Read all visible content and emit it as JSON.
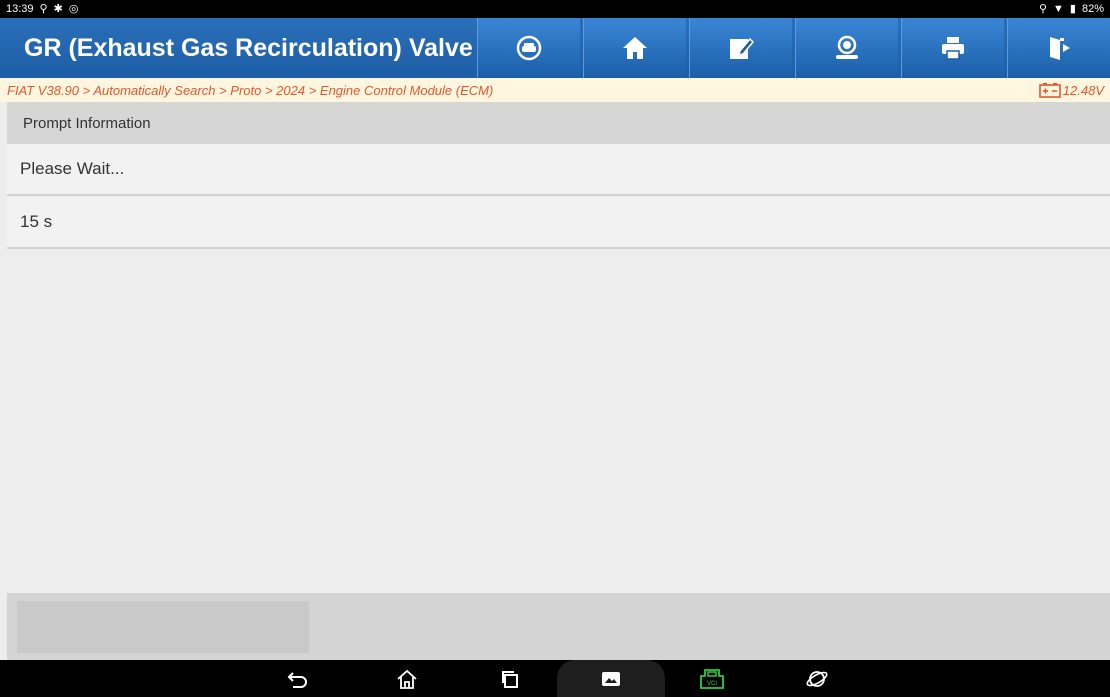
{
  "status_bar": {
    "time": "13:39",
    "battery": "82%",
    "left_icons": [
      "usb-icon",
      "bluetooth-icon",
      "message-icon"
    ],
    "right_icons": [
      "location-icon",
      "wifi-icon",
      "battery-icon"
    ]
  },
  "header": {
    "title": "GR (Exhaust Gas Recirculation) Valve I",
    "toolbar": [
      "car-diagnostic-icon",
      "home-icon",
      "edit-icon",
      "user-support-icon",
      "print-icon",
      "exit-icon"
    ]
  },
  "breadcrumb": {
    "path": "FIAT V38.90 > Automatically Search > Proto > 2024 > Engine Control Module (ECM)",
    "voltage": "12.48V"
  },
  "prompt": {
    "heading": "Prompt Information",
    "message": "Please Wait...",
    "countdown": "15 s"
  },
  "nav_bar": [
    "back-icon",
    "home-icon",
    "recents-icon",
    "gallery-icon",
    "vci-icon",
    "browser-icon"
  ],
  "colors": {
    "header_bg": "#1d5ea6",
    "breadcrumb_text": "#e4572e",
    "breadcrumb_bg": "#fff6e0",
    "vci_icon": "#2ecc40"
  }
}
